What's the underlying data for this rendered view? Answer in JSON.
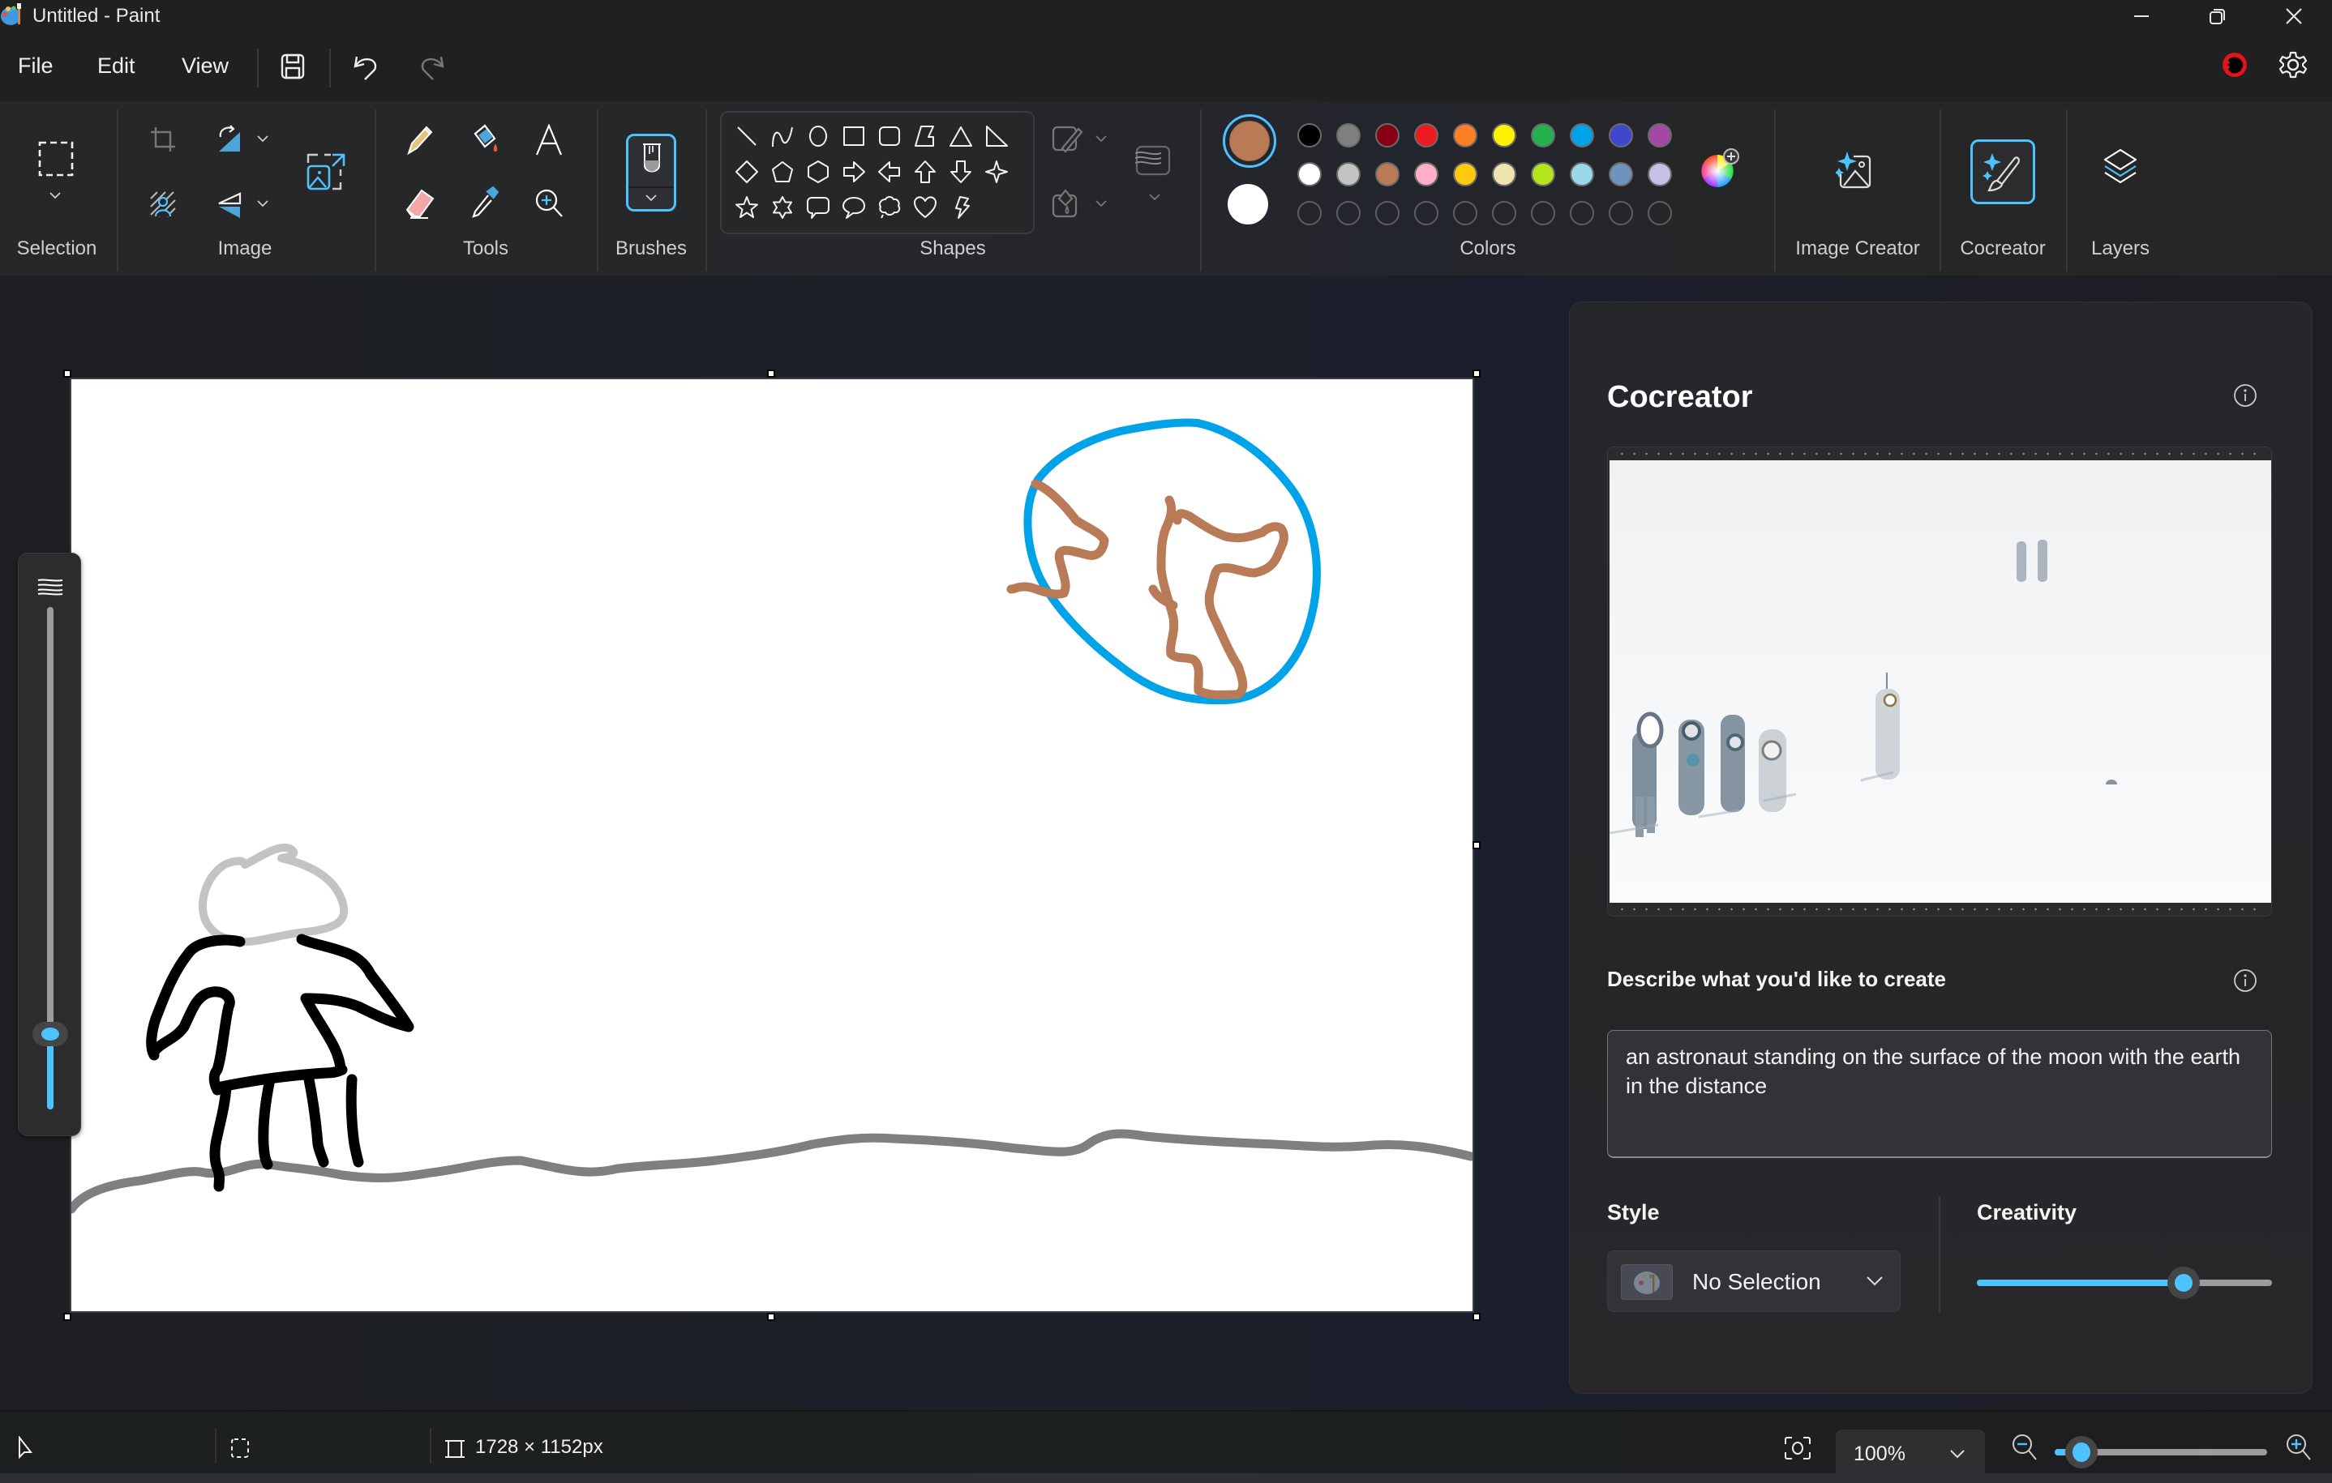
{
  "window": {
    "title": "Untitled - Paint",
    "controls": [
      "minimize",
      "restore",
      "close"
    ]
  },
  "menu": {
    "items": [
      "File",
      "Edit",
      "View"
    ],
    "save_icon": "save-icon",
    "undo_icon": "undo-icon",
    "redo_icon": "redo-icon",
    "account_icon": "account-avatar",
    "settings_icon": "gear-icon"
  },
  "ribbon": {
    "groups": {
      "selection": "Selection",
      "image": "Image",
      "tools": "Tools",
      "brushes": "Brushes",
      "shapes": "Shapes",
      "colors": "Colors",
      "image_creator": "Image Creator",
      "cocreator": "Cocreator",
      "layers": "Layers"
    },
    "shapes": [
      "line",
      "curve",
      "oval",
      "rectangle",
      "rounded-rectangle",
      "polygon",
      "triangle",
      "right-triangle",
      "diamond",
      "pentagon",
      "hexagon",
      "right-arrow",
      "left-arrow",
      "up-arrow",
      "down-arrow",
      "four-point-star",
      "five-point-star",
      "six-point-star",
      "rounded-callout",
      "oval-callout",
      "cloud-callout",
      "heart",
      "lightning"
    ],
    "colors": {
      "primary": "#b97a56",
      "secondary": "#ffffff",
      "palette_row1": [
        "#000000",
        "#7f7f7f",
        "#880015",
        "#ed1c24",
        "#ff7f27",
        "#fff200",
        "#22b14c",
        "#00a2e8",
        "#3f48cc",
        "#a349a4"
      ],
      "palette_row2": [
        "#ffffff",
        "#c3c3c3",
        "#b97a57",
        "#ffaec9",
        "#ffc90e",
        "#efe4b0",
        "#b5e61d",
        "#99d9ea",
        "#7092be",
        "#c8bfe7"
      ],
      "custom_slots": 10
    },
    "accent": "#4cc2ff"
  },
  "canvas": {
    "drawing_colors": {
      "earth_ocean": "#00a2e8",
      "earth_land": "#b97a57",
      "helmet": "#c3c3c3",
      "body": "#000000",
      "ground": "#7f7f7f"
    }
  },
  "brush_size": {
    "value_fraction": 0.15
  },
  "cocreator": {
    "title": "Cocreator",
    "describe_label": "Describe what you'd like to create",
    "prompt": "an astronaut standing on the surface of the moon with the earth in the distance",
    "style_label": "Style",
    "style_value": "No Selection",
    "creativity_label": "Creativity",
    "creativity_fraction": 0.7
  },
  "status": {
    "canvas_size": "1728 × 1152px",
    "zoom": "100%",
    "zoom_slider_fraction": 0.05
  }
}
